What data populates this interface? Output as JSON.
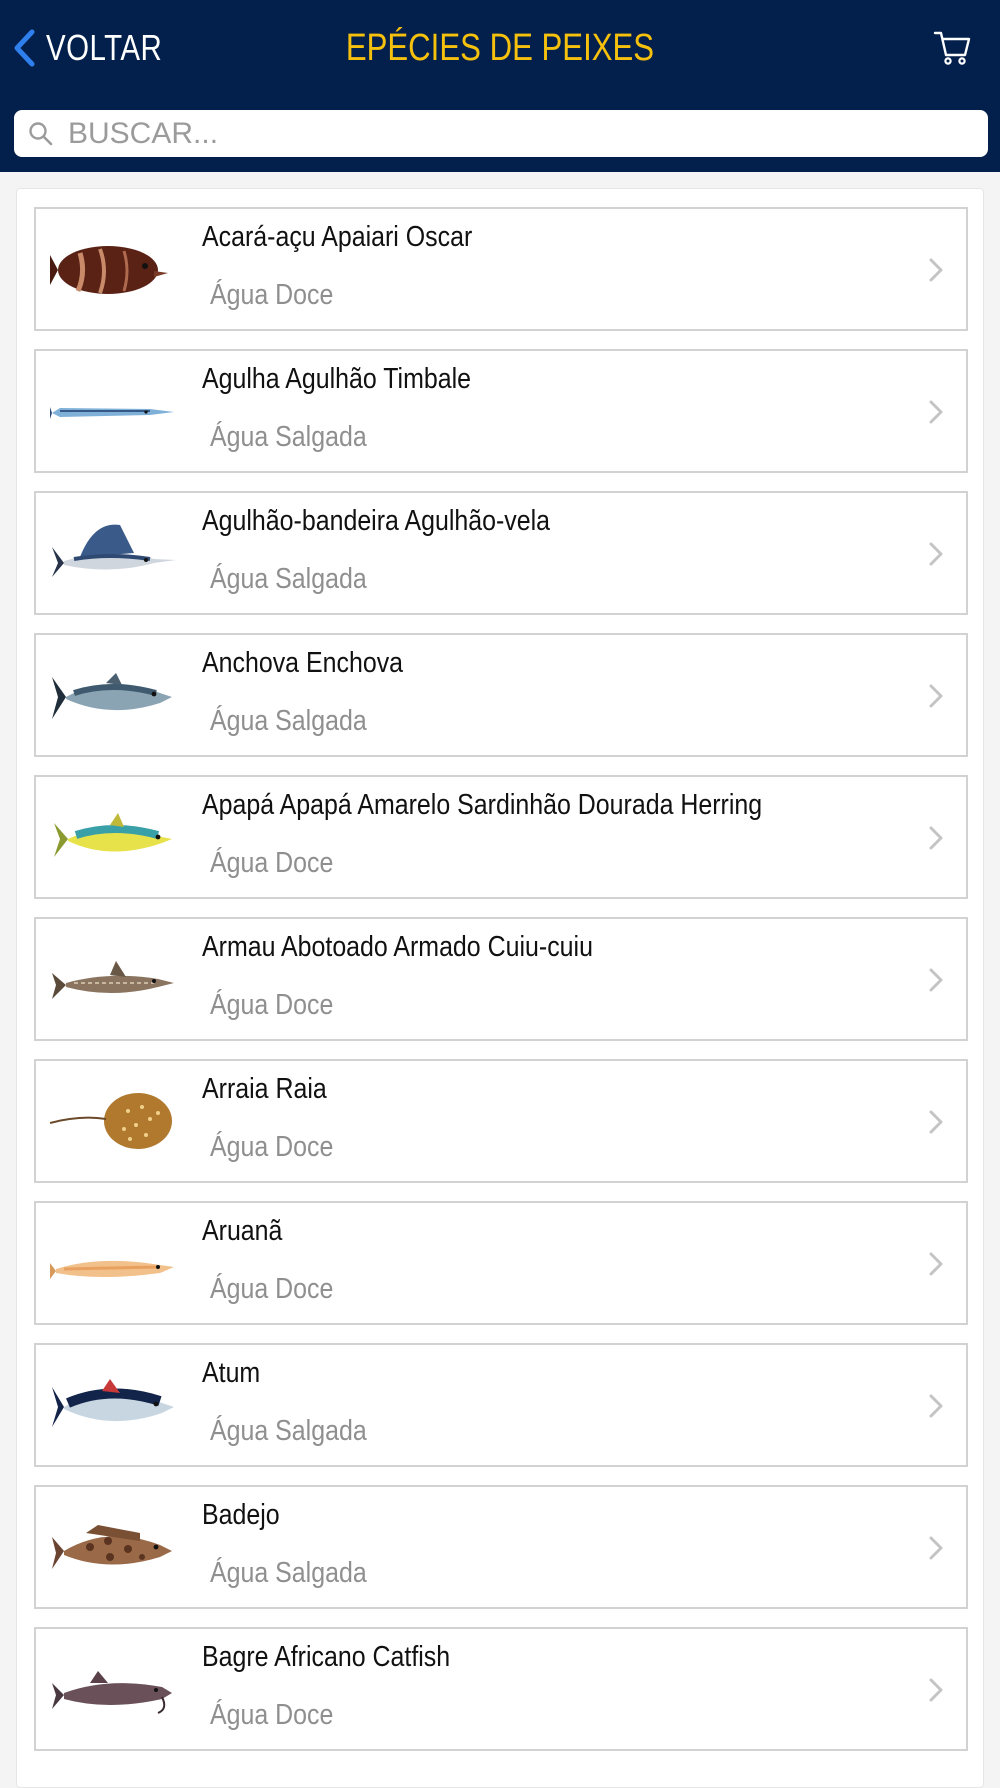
{
  "header": {
    "back_label": "VOLTAR",
    "title": "EPÉCIES DE PEIXES",
    "cart_icon": "cart-icon",
    "colors": {
      "background": "#031f4b",
      "title": "#f5c10d",
      "back_chevron": "#2f80ed"
    }
  },
  "search": {
    "placeholder": "BUSCAR...",
    "icon": "search-icon"
  },
  "species": [
    {
      "name": "Acará-açu Apaiari Oscar",
      "water": "Água Doce",
      "fish": "oscar"
    },
    {
      "name": "Agulha Agulhão Timbale",
      "water": "Água Salgada",
      "fish": "needlefish"
    },
    {
      "name": "Agulhão-bandeira Agulhão-vela",
      "water": "Água Salgada",
      "fish": "sailfish"
    },
    {
      "name": "Anchova Enchova",
      "water": "Água Salgada",
      "fish": "bluefish"
    },
    {
      "name": "Apapá Apapá Amarelo Sardinhão Dourada Herring",
      "water": "Água Doce",
      "fish": "herring"
    },
    {
      "name": "Armau Abotoado Armado Cuiu-cuiu",
      "water": "Água Doce",
      "fish": "catfish-armored"
    },
    {
      "name": "Arraia Raia",
      "water": "Água Doce",
      "fish": "stingray"
    },
    {
      "name": "Aruanã",
      "water": "Água Doce",
      "fish": "arowana"
    },
    {
      "name": "Atum",
      "water": "Água Salgada",
      "fish": "tuna"
    },
    {
      "name": "Badejo",
      "water": "Água Salgada",
      "fish": "grouper"
    },
    {
      "name": "Bagre Africano Catfish",
      "water": "Água Doce",
      "fish": "catfish"
    }
  ]
}
